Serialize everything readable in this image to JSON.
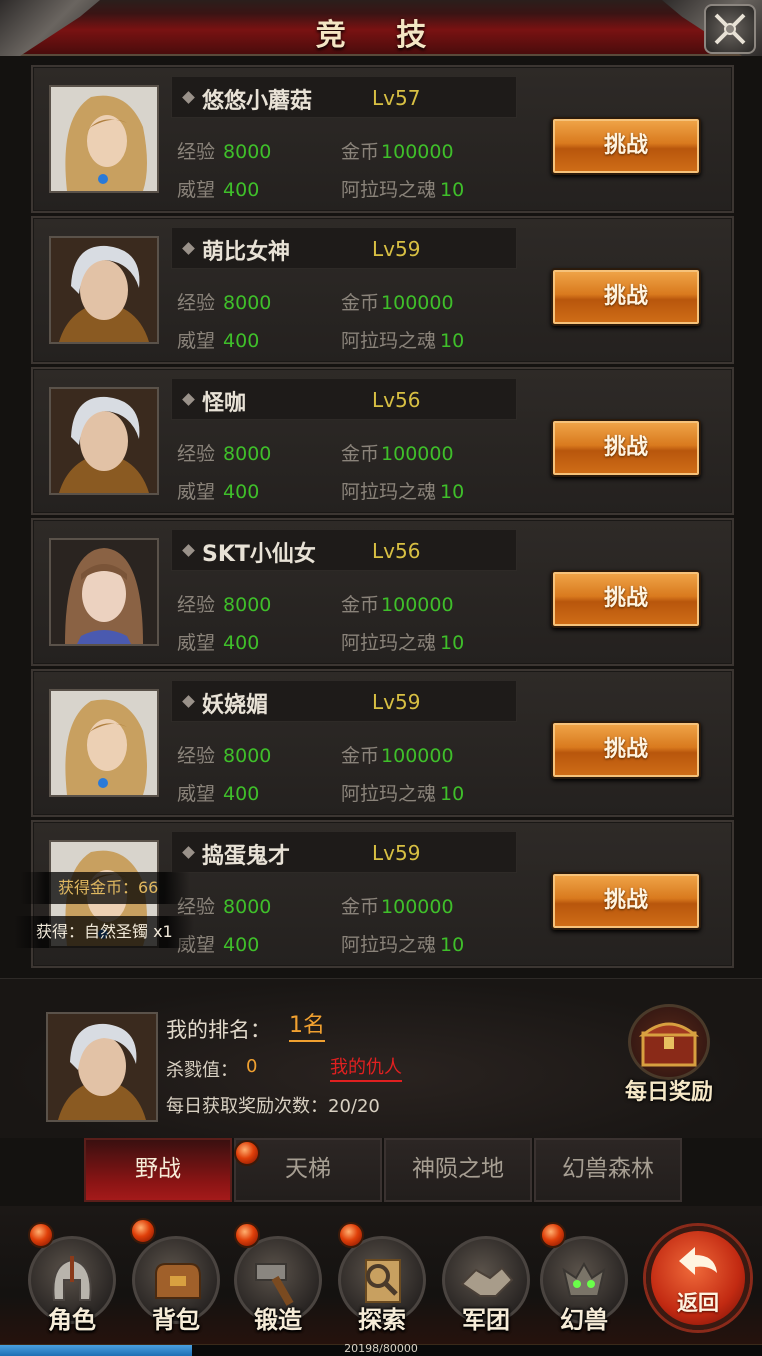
{
  "title": "竞 技",
  "opponents": [
    {
      "name": "悠悠小蘑菇",
      "level": "Lv57",
      "exp_label": "经验",
      "exp": "8000",
      "gold_label": "金币",
      "gold": "100000",
      "prestige_label": "威望",
      "prestige": "400",
      "soul_label": "阿拉玛之魂",
      "soul": "10",
      "challenge": "挑战",
      "avatar": "blonde-female-portrait"
    },
    {
      "name": "萌比女神",
      "level": "Lv59",
      "exp_label": "经验",
      "exp": "8000",
      "gold_label": "金币",
      "gold": "100000",
      "prestige_label": "威望",
      "prestige": "400",
      "soul_label": "阿拉玛之魂",
      "soul": "10",
      "challenge": "挑战",
      "avatar": "silver-hair-male-portrait"
    },
    {
      "name": "怪咖",
      "level": "Lv56",
      "exp_label": "经验",
      "exp": "8000",
      "gold_label": "金币",
      "gold": "100000",
      "prestige_label": "威望",
      "prestige": "400",
      "soul_label": "阿拉玛之魂",
      "soul": "10",
      "challenge": "挑战",
      "avatar": "silver-hair-male-portrait"
    },
    {
      "name": "SKT小仙女",
      "level": "Lv56",
      "exp_label": "经验",
      "exp": "8000",
      "gold_label": "金币",
      "gold": "100000",
      "prestige_label": "威望",
      "prestige": "400",
      "soul_label": "阿拉玛之魂",
      "soul": "10",
      "challenge": "挑战",
      "avatar": "brown-hair-female-portrait"
    },
    {
      "name": "妖娆媚",
      "level": "Lv59",
      "exp_label": "经验",
      "exp": "8000",
      "gold_label": "金币",
      "gold": "100000",
      "prestige_label": "威望",
      "prestige": "400",
      "soul_label": "阿拉玛之魂",
      "soul": "10",
      "challenge": "挑战",
      "avatar": "blonde-female-portrait"
    },
    {
      "name": "捣蛋鬼才",
      "level": "Lv59",
      "exp_label": "经验",
      "exp": "8000",
      "gold_label": "金币",
      "gold": "100000",
      "prestige_label": "威望",
      "prestige": "400",
      "soul_label": "阿拉玛之魂",
      "soul": "10",
      "challenge": "挑战",
      "avatar": "blonde-female-portrait"
    }
  ],
  "toasts": {
    "gold": "获得金币：66",
    "item": "获得：自然圣镯 x1"
  },
  "my_rank": {
    "rank_label": "我的排名：",
    "rank_value": "1名",
    "kill_label": "杀戮值：",
    "kill_value": "0",
    "enemy_link": "我的仇人",
    "daily_count": "每日获取奖励次数：20/20",
    "daily_reward": "每日奖励"
  },
  "tabs": [
    {
      "label": "野战",
      "active": true
    },
    {
      "label": "天梯",
      "active": false
    },
    {
      "label": "神陨之地",
      "active": false
    },
    {
      "label": "幻兽森林",
      "active": false
    }
  ],
  "nav": [
    {
      "label": "角色",
      "icon": "helmet-icon"
    },
    {
      "label": "背包",
      "icon": "bag-icon"
    },
    {
      "label": "锻造",
      "icon": "hammer-icon"
    },
    {
      "label": "探索",
      "icon": "magnifier-map-icon"
    },
    {
      "label": "军团",
      "icon": "handshake-icon"
    },
    {
      "label": "幻兽",
      "icon": "beast-skull-icon"
    }
  ],
  "back_label": "返回",
  "exp_bar": {
    "text": "20198/80000",
    "fraction": 0.2525
  },
  "colors": {
    "accent_red": "#8a1414",
    "value_green": "#3fbf2a",
    "level_yellow": "#d8c043",
    "button_orange": "#d97a1e",
    "rank_orange": "#f0a030",
    "link_red": "#e02020"
  }
}
